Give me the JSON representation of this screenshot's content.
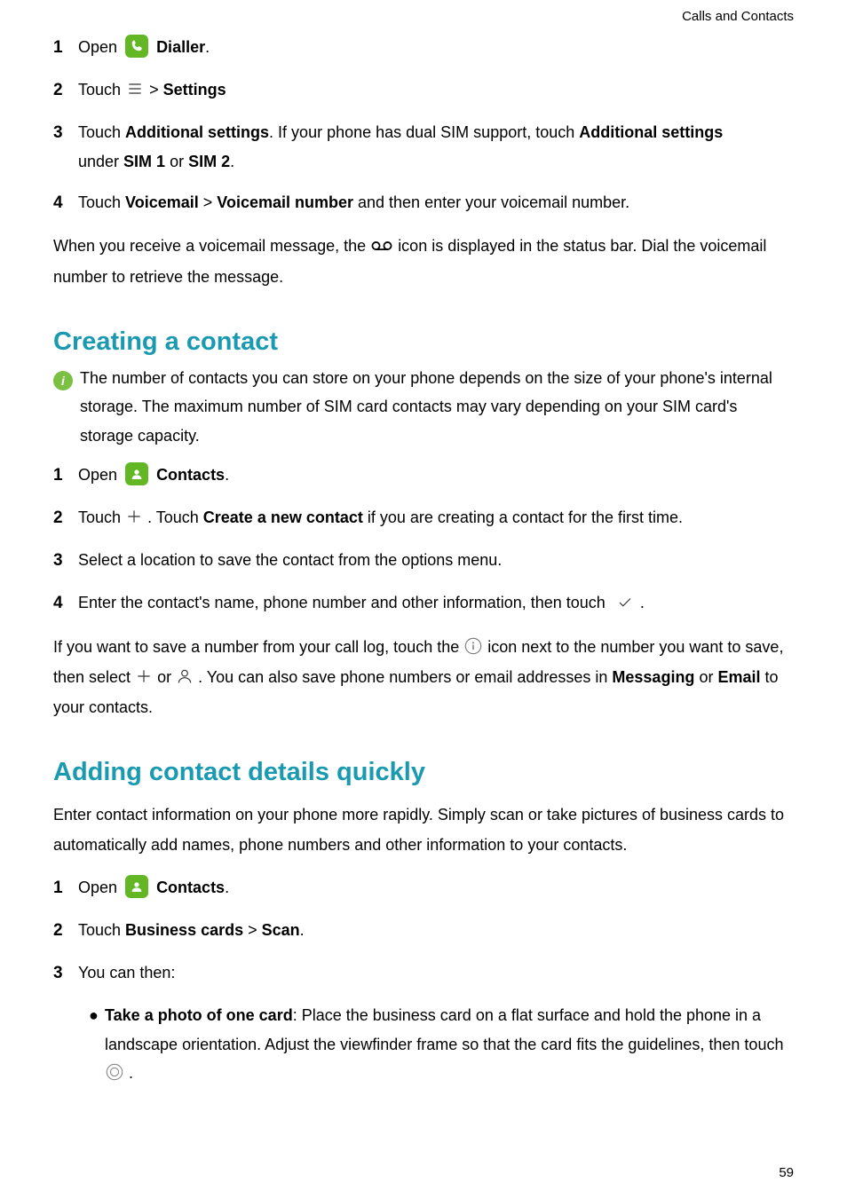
{
  "breadcrumb": "Calls and Contacts",
  "pageNumber": "59",
  "voicemailSteps": {
    "s1": {
      "num": "1",
      "a": "Open ",
      "b": "Dialler",
      "c": "."
    },
    "s2": {
      "num": "2",
      "a": "Touch ",
      "b": " > ",
      "c": "Settings"
    },
    "s3": {
      "num": "3",
      "a": "Touch ",
      "b": "Additional settings",
      "c": ". If your phone has dual SIM support, touch ",
      "d": "Additional settings",
      "e": "under ",
      "f": "SIM 1",
      "g": " or ",
      "h": "SIM 2",
      "i": "."
    },
    "s4": {
      "num": "4",
      "a": "Touch ",
      "b": "Voicemail",
      "c": " > ",
      "d": "Voicemail number",
      "e": " and then enter your voicemail number."
    }
  },
  "voicemailPara": {
    "a": "When you receive a voicemail message, the ",
    "b": " icon is displayed in the status bar. Dial the voicemail number to retrieve the message."
  },
  "creating": {
    "title": "Creating a contact",
    "note": "The number of contacts you can store on your phone depends on the size of your phone's internal storage. The maximum number of SIM card contacts may vary depending on your SIM card's storage capacity.",
    "s1": {
      "num": "1",
      "a": "Open ",
      "b": "Contacts",
      "c": "."
    },
    "s2": {
      "num": "2",
      "a": "Touch ",
      "b": " . Touch ",
      "c": "Create a new contact",
      "d": " if you are creating a contact for the first time."
    },
    "s3": {
      "num": "3",
      "a": "Select a location to save the contact from the options menu."
    },
    "s4": {
      "num": "4",
      "a": "Enter the contact's name, phone number and other information, then touch ",
      "b": "."
    },
    "para": {
      "a": "If you want to save a number from your call log, touch the ",
      "b": " icon next to the number you want to save, then select ",
      "c": " or ",
      "d": " . You can also save phone numbers or email addresses in ",
      "e": "Messaging",
      "f": " or ",
      "g": "Email",
      "h": " to your contacts."
    }
  },
  "adding": {
    "title": "Adding contact details quickly",
    "intro": "Enter contact information on your phone more rapidly. Simply scan or take pictures of business cards to automatically add names, phone numbers and other information to your contacts.",
    "s1": {
      "num": "1",
      "a": "Open ",
      "b": "Contacts",
      "c": "."
    },
    "s2": {
      "num": "2",
      "a": "Touch ",
      "b": "Business cards",
      "c": " > ",
      "d": "Scan",
      "e": "."
    },
    "s3": {
      "num": "3",
      "a": "You can then:"
    },
    "bullet1": {
      "a": "Take a photo of one card",
      "b": ": Place the business card on a flat surface and hold the phone in a landscape orientation. Adjust the viewfinder frame so that the card fits the guidelines, then touch ",
      "c": " ."
    }
  }
}
